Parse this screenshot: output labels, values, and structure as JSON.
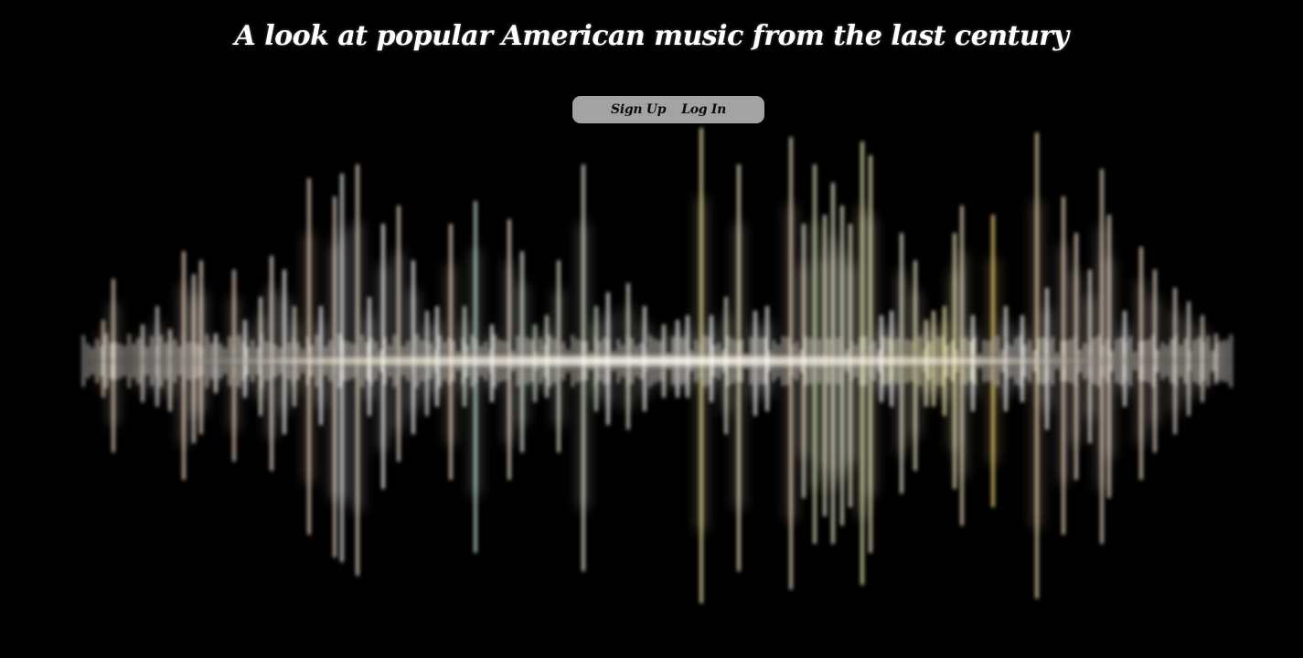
{
  "header": {
    "title": "A look at popular American music from the last century"
  },
  "nav": {
    "signup_label": "Sign Up",
    "login_label": "Log In"
  },
  "colors": {
    "background": "#000000",
    "nav_bg": "#a3a3a3",
    "title": "#ffffff"
  },
  "hero_image": {
    "icon": "sound-waveform-graphic"
  }
}
